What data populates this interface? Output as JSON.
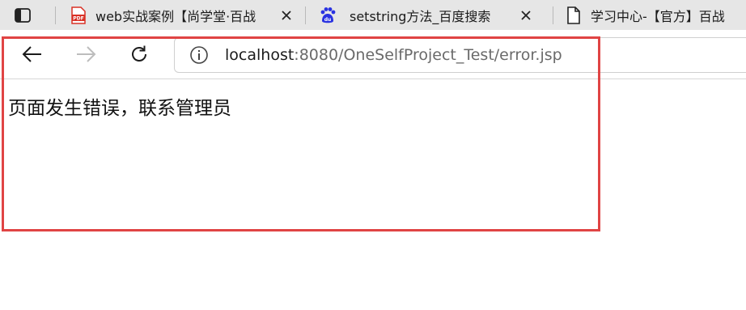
{
  "tabs": [
    {
      "title": "web实战案例【尚学堂·百战",
      "icon": "pdf-icon"
    },
    {
      "title": "setstring方法_百度搜索",
      "icon": "baidu-icon"
    },
    {
      "title": "学习中心-【官方】百战",
      "icon": "page-icon"
    }
  ],
  "address_bar": {
    "host": "localhost",
    "path": ":8080/OneSelfProject_Test/error.jsp"
  },
  "page": {
    "message": "页面发生错误，联系管理员"
  },
  "colors": {
    "highlight_border": "#e04444",
    "pdf_red": "#d93025",
    "baidu_blue": "#2932e1"
  }
}
